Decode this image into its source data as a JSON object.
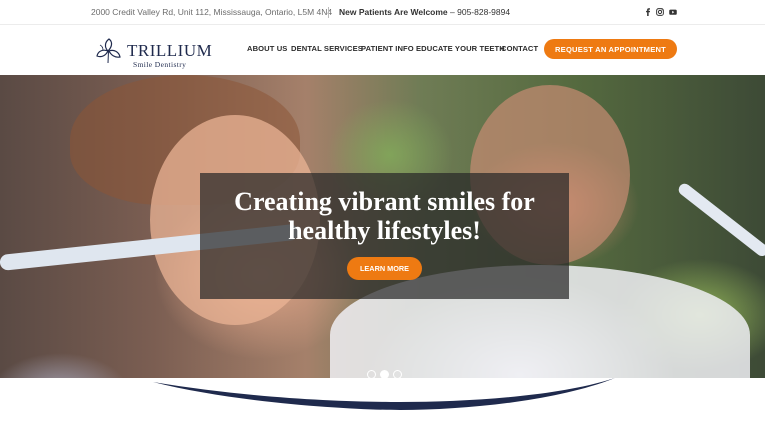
{
  "topbar": {
    "address": "2000 Credit Valley Rd, Unit 112, Mississauga, Ontario, L5M 4N4",
    "new_patients_label": "New Patients Are Welcome",
    "phone": "– 905-828-9894",
    "social_icons": [
      "facebook-icon",
      "instagram-icon",
      "youtube-icon"
    ]
  },
  "logo": {
    "name": "TRILLIUM",
    "subtitle": "Smile Dentistry"
  },
  "nav": {
    "items": [
      {
        "label": "ABOUT US"
      },
      {
        "label": "DENTAL SERVICES"
      },
      {
        "label": "PATIENT INFO"
      },
      {
        "label": "EDUCATE YOUR TEETH"
      },
      {
        "label": "CONTACT"
      }
    ],
    "cta_label": "REQUEST AN APPOINTMENT"
  },
  "hero": {
    "headline_line1": "Creating vibrant smiles for",
    "headline_line2": "healthy lifestyles!",
    "button_label": "LEARN MORE",
    "slides_total": 3,
    "active_slide": 2
  },
  "colors": {
    "accent": "#ee7a12",
    "navy": "#1f2a4d",
    "overlay": "#282828"
  }
}
